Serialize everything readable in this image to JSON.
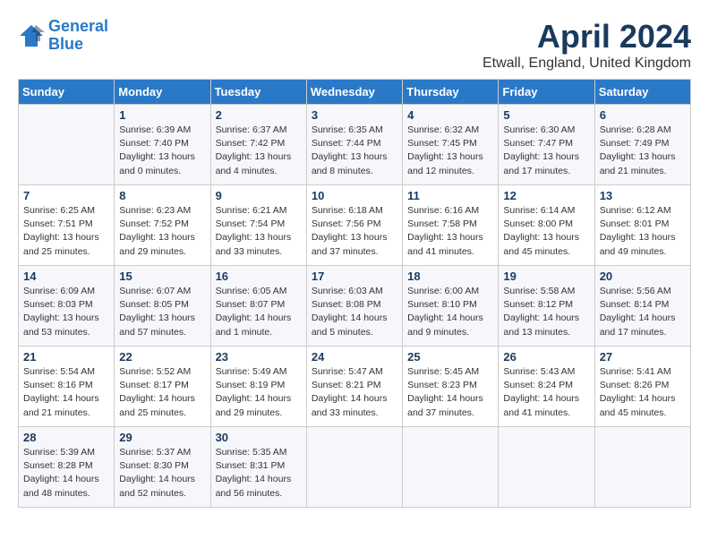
{
  "logo": {
    "line1": "General",
    "line2": "Blue"
  },
  "title": "April 2024",
  "location": "Etwall, England, United Kingdom",
  "days_of_week": [
    "Sunday",
    "Monday",
    "Tuesday",
    "Wednesday",
    "Thursday",
    "Friday",
    "Saturday"
  ],
  "weeks": [
    [
      {
        "day": "",
        "info": ""
      },
      {
        "day": "1",
        "info": "Sunrise: 6:39 AM\nSunset: 7:40 PM\nDaylight: 13 hours\nand 0 minutes."
      },
      {
        "day": "2",
        "info": "Sunrise: 6:37 AM\nSunset: 7:42 PM\nDaylight: 13 hours\nand 4 minutes."
      },
      {
        "day": "3",
        "info": "Sunrise: 6:35 AM\nSunset: 7:44 PM\nDaylight: 13 hours\nand 8 minutes."
      },
      {
        "day": "4",
        "info": "Sunrise: 6:32 AM\nSunset: 7:45 PM\nDaylight: 13 hours\nand 12 minutes."
      },
      {
        "day": "5",
        "info": "Sunrise: 6:30 AM\nSunset: 7:47 PM\nDaylight: 13 hours\nand 17 minutes."
      },
      {
        "day": "6",
        "info": "Sunrise: 6:28 AM\nSunset: 7:49 PM\nDaylight: 13 hours\nand 21 minutes."
      }
    ],
    [
      {
        "day": "7",
        "info": "Sunrise: 6:25 AM\nSunset: 7:51 PM\nDaylight: 13 hours\nand 25 minutes."
      },
      {
        "day": "8",
        "info": "Sunrise: 6:23 AM\nSunset: 7:52 PM\nDaylight: 13 hours\nand 29 minutes."
      },
      {
        "day": "9",
        "info": "Sunrise: 6:21 AM\nSunset: 7:54 PM\nDaylight: 13 hours\nand 33 minutes."
      },
      {
        "day": "10",
        "info": "Sunrise: 6:18 AM\nSunset: 7:56 PM\nDaylight: 13 hours\nand 37 minutes."
      },
      {
        "day": "11",
        "info": "Sunrise: 6:16 AM\nSunset: 7:58 PM\nDaylight: 13 hours\nand 41 minutes."
      },
      {
        "day": "12",
        "info": "Sunrise: 6:14 AM\nSunset: 8:00 PM\nDaylight: 13 hours\nand 45 minutes."
      },
      {
        "day": "13",
        "info": "Sunrise: 6:12 AM\nSunset: 8:01 PM\nDaylight: 13 hours\nand 49 minutes."
      }
    ],
    [
      {
        "day": "14",
        "info": "Sunrise: 6:09 AM\nSunset: 8:03 PM\nDaylight: 13 hours\nand 53 minutes."
      },
      {
        "day": "15",
        "info": "Sunrise: 6:07 AM\nSunset: 8:05 PM\nDaylight: 13 hours\nand 57 minutes."
      },
      {
        "day": "16",
        "info": "Sunrise: 6:05 AM\nSunset: 8:07 PM\nDaylight: 14 hours\nand 1 minute."
      },
      {
        "day": "17",
        "info": "Sunrise: 6:03 AM\nSunset: 8:08 PM\nDaylight: 14 hours\nand 5 minutes."
      },
      {
        "day": "18",
        "info": "Sunrise: 6:00 AM\nSunset: 8:10 PM\nDaylight: 14 hours\nand 9 minutes."
      },
      {
        "day": "19",
        "info": "Sunrise: 5:58 AM\nSunset: 8:12 PM\nDaylight: 14 hours\nand 13 minutes."
      },
      {
        "day": "20",
        "info": "Sunrise: 5:56 AM\nSunset: 8:14 PM\nDaylight: 14 hours\nand 17 minutes."
      }
    ],
    [
      {
        "day": "21",
        "info": "Sunrise: 5:54 AM\nSunset: 8:16 PM\nDaylight: 14 hours\nand 21 minutes."
      },
      {
        "day": "22",
        "info": "Sunrise: 5:52 AM\nSunset: 8:17 PM\nDaylight: 14 hours\nand 25 minutes."
      },
      {
        "day": "23",
        "info": "Sunrise: 5:49 AM\nSunset: 8:19 PM\nDaylight: 14 hours\nand 29 minutes."
      },
      {
        "day": "24",
        "info": "Sunrise: 5:47 AM\nSunset: 8:21 PM\nDaylight: 14 hours\nand 33 minutes."
      },
      {
        "day": "25",
        "info": "Sunrise: 5:45 AM\nSunset: 8:23 PM\nDaylight: 14 hours\nand 37 minutes."
      },
      {
        "day": "26",
        "info": "Sunrise: 5:43 AM\nSunset: 8:24 PM\nDaylight: 14 hours\nand 41 minutes."
      },
      {
        "day": "27",
        "info": "Sunrise: 5:41 AM\nSunset: 8:26 PM\nDaylight: 14 hours\nand 45 minutes."
      }
    ],
    [
      {
        "day": "28",
        "info": "Sunrise: 5:39 AM\nSunset: 8:28 PM\nDaylight: 14 hours\nand 48 minutes."
      },
      {
        "day": "29",
        "info": "Sunrise: 5:37 AM\nSunset: 8:30 PM\nDaylight: 14 hours\nand 52 minutes."
      },
      {
        "day": "30",
        "info": "Sunrise: 5:35 AM\nSunset: 8:31 PM\nDaylight: 14 hours\nand 56 minutes."
      },
      {
        "day": "",
        "info": ""
      },
      {
        "day": "",
        "info": ""
      },
      {
        "day": "",
        "info": ""
      },
      {
        "day": "",
        "info": ""
      }
    ]
  ]
}
